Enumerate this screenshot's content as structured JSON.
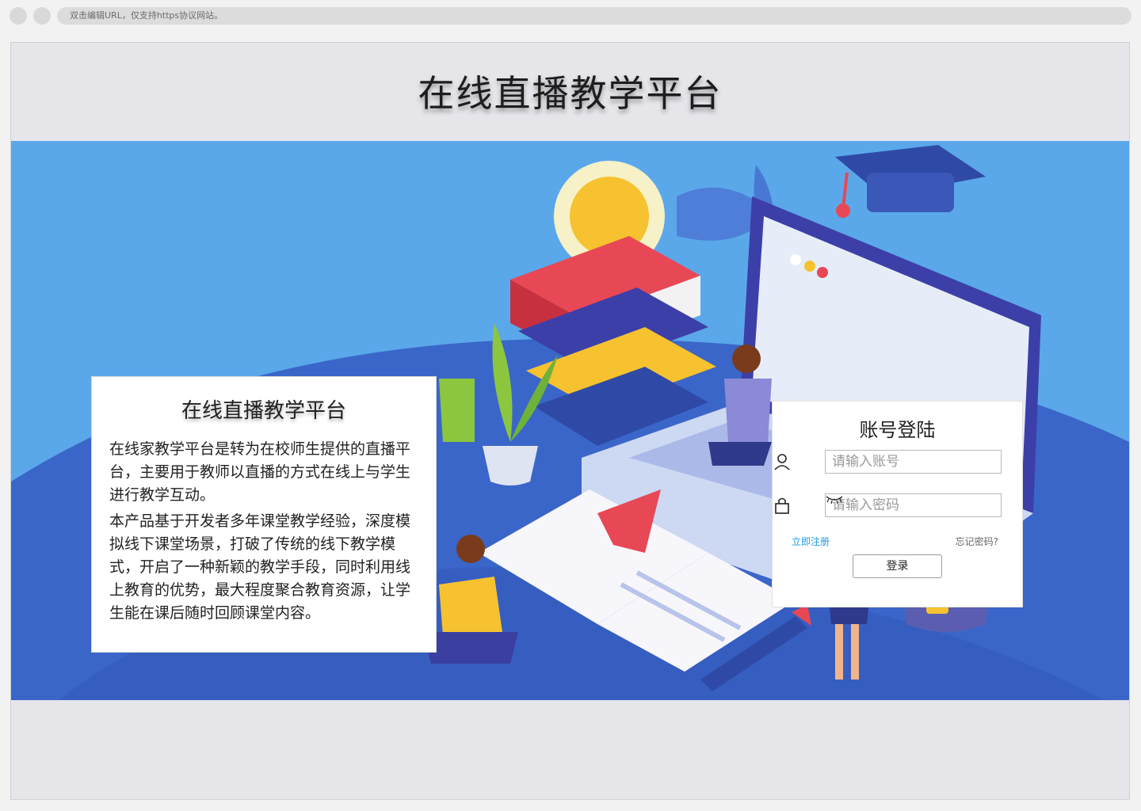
{
  "browser": {
    "url_hint": "双击编辑URL，仅支持https协议网站。"
  },
  "page": {
    "title": "在线直播教学平台"
  },
  "intro": {
    "title": "在线直播教学平台",
    "paragraph1": "在线家教学平台是转为在校师生提供的直播平台，主要用于教师以直播的方式在线上与学生进行教学互动。",
    "paragraph2": "本产品基于开发者多年课堂教学经验，深度模拟线下课堂场景，打破了传统的线下教学模式，开启了一种新颖的教学手段，同时利用线上教育的优势，最大程度聚合教育资源，让学生能在课后随时回顾课堂内容。"
  },
  "login": {
    "title": "账号登陆",
    "account_placeholder": "请输入账号",
    "password_placeholder": "请输入密码",
    "register_link": "立即注册",
    "forgot_link": "忘记密码?",
    "submit_label": "登录"
  },
  "icons": {
    "account": "user-icon",
    "password": "lock-icon",
    "toggle_visibility": "eye-closed-icon"
  },
  "colors": {
    "banner_blue": "#5aa8ea",
    "banner_dark_blue": "#3a66c9",
    "link_blue": "#1e9be6"
  }
}
